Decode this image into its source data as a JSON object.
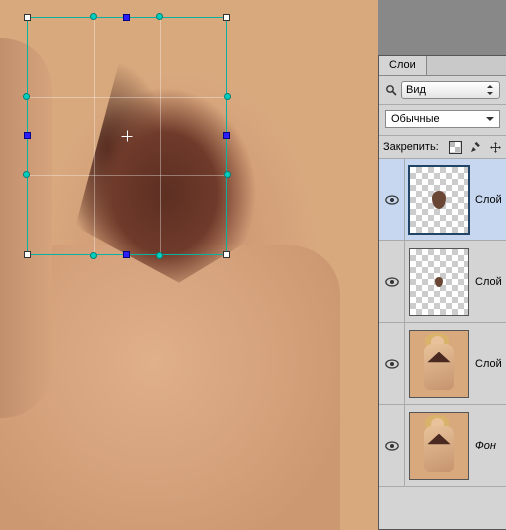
{
  "panel_tab": "Слои",
  "view_select": "Вид",
  "blend_mode": "Обычные",
  "lock_label": "Закрепить:",
  "layers": [
    {
      "name": "Слой",
      "selected": true,
      "transparent": true,
      "shape": "blob1"
    },
    {
      "name": "Слой",
      "selected": false,
      "transparent": true,
      "shape": "blob2"
    },
    {
      "name": "Слой",
      "selected": false,
      "transparent": false,
      "shape": "person"
    },
    {
      "name": "Фон",
      "selected": false,
      "transparent": false,
      "shape": "person",
      "bg": true
    }
  ]
}
